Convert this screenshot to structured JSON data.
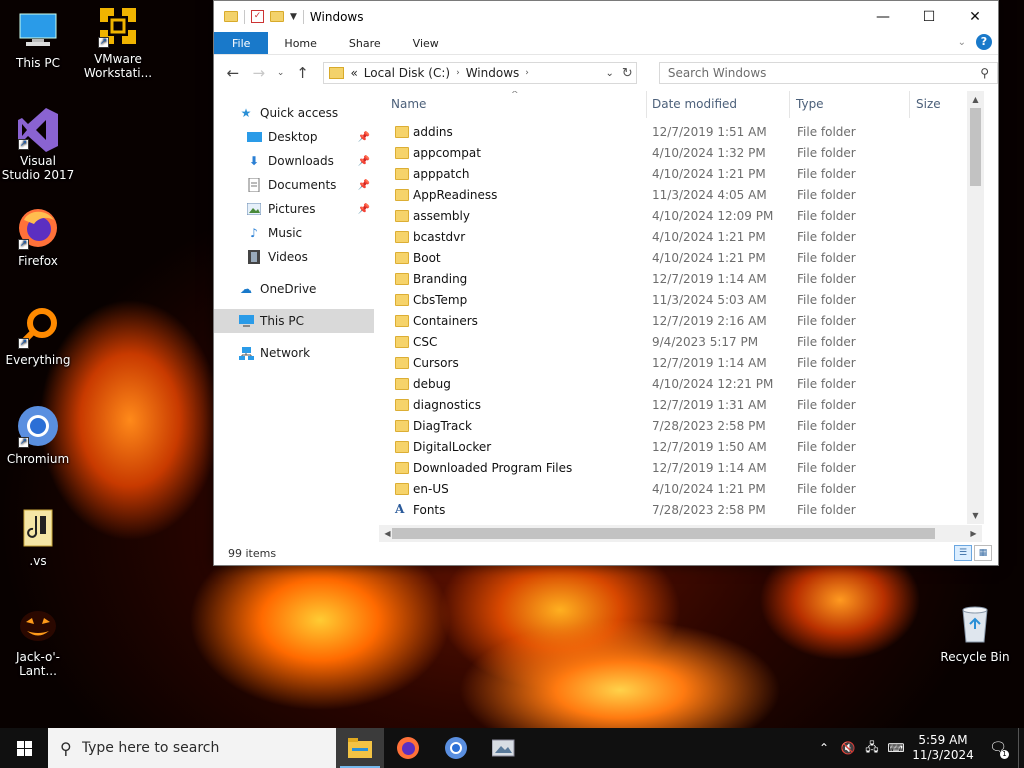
{
  "desktop": {
    "icons": [
      {
        "label": "This PC"
      },
      {
        "label": "VMware Workstati..."
      },
      {
        "label": "Visual Studio 2017"
      },
      {
        "label": "Firefox"
      },
      {
        "label": "Everything"
      },
      {
        "label": "Chromium"
      },
      {
        "label": ".vs"
      },
      {
        "label": "Jack-o'-Lant..."
      },
      {
        "label": "Recycle Bin"
      }
    ]
  },
  "window": {
    "title": "Windows",
    "controls": {
      "minimize": "—",
      "maximize": "☐",
      "close": "✕"
    },
    "ribbon_tabs": [
      "File",
      "Home",
      "Share",
      "View"
    ],
    "address": {
      "prefix": "«",
      "crumbs": [
        "Local Disk (C:)",
        "Windows"
      ]
    },
    "search": {
      "placeholder": "Search Windows"
    },
    "nav_pane": {
      "quick_access": "Quick access",
      "pinned": [
        "Desktop",
        "Downloads",
        "Documents",
        "Pictures"
      ],
      "unpinned": [
        "Music",
        "Videos"
      ],
      "onedrive": "OneDrive",
      "this_pc": "This PC",
      "network": "Network"
    },
    "columns": {
      "name": "Name",
      "date": "Date modified",
      "type": "Type",
      "size": "Size"
    },
    "files": [
      {
        "name": "addins",
        "date": "12/7/2019 1:51 AM",
        "type": "File folder"
      },
      {
        "name": "appcompat",
        "date": "4/10/2024 1:32 PM",
        "type": "File folder"
      },
      {
        "name": "apppatch",
        "date": "4/10/2024 1:21 PM",
        "type": "File folder"
      },
      {
        "name": "AppReadiness",
        "date": "11/3/2024 4:05 AM",
        "type": "File folder"
      },
      {
        "name": "assembly",
        "date": "4/10/2024 12:09 PM",
        "type": "File folder"
      },
      {
        "name": "bcastdvr",
        "date": "4/10/2024 1:21 PM",
        "type": "File folder"
      },
      {
        "name": "Boot",
        "date": "4/10/2024 1:21 PM",
        "type": "File folder"
      },
      {
        "name": "Branding",
        "date": "12/7/2019 1:14 AM",
        "type": "File folder"
      },
      {
        "name": "CbsTemp",
        "date": "11/3/2024 5:03 AM",
        "type": "File folder"
      },
      {
        "name": "Containers",
        "date": "12/7/2019 2:16 AM",
        "type": "File folder"
      },
      {
        "name": "CSC",
        "date": "9/4/2023 5:17 PM",
        "type": "File folder"
      },
      {
        "name": "Cursors",
        "date": "12/7/2019 1:14 AM",
        "type": "File folder"
      },
      {
        "name": "debug",
        "date": "4/10/2024 12:21 PM",
        "type": "File folder"
      },
      {
        "name": "diagnostics",
        "date": "12/7/2019 1:31 AM",
        "type": "File folder"
      },
      {
        "name": "DiagTrack",
        "date": "7/28/2023 2:58 PM",
        "type": "File folder"
      },
      {
        "name": "DigitalLocker",
        "date": "12/7/2019 1:50 AM",
        "type": "File folder"
      },
      {
        "name": "Downloaded Program Files",
        "date": "12/7/2019 1:14 AM",
        "type": "File folder"
      },
      {
        "name": "en-US",
        "date": "4/10/2024 1:21 PM",
        "type": "File folder"
      },
      {
        "name": "Fonts",
        "date": "7/28/2023 2:58 PM",
        "type": "File folder"
      }
    ],
    "status": "99 items"
  },
  "taskbar": {
    "search_placeholder": "Type here to search",
    "clock_time": "5:59 AM",
    "clock_date": "11/3/2024"
  },
  "colors": {
    "accent": "#1979ca",
    "folder": "#f6d36a",
    "selection": "#d9d9d9"
  }
}
